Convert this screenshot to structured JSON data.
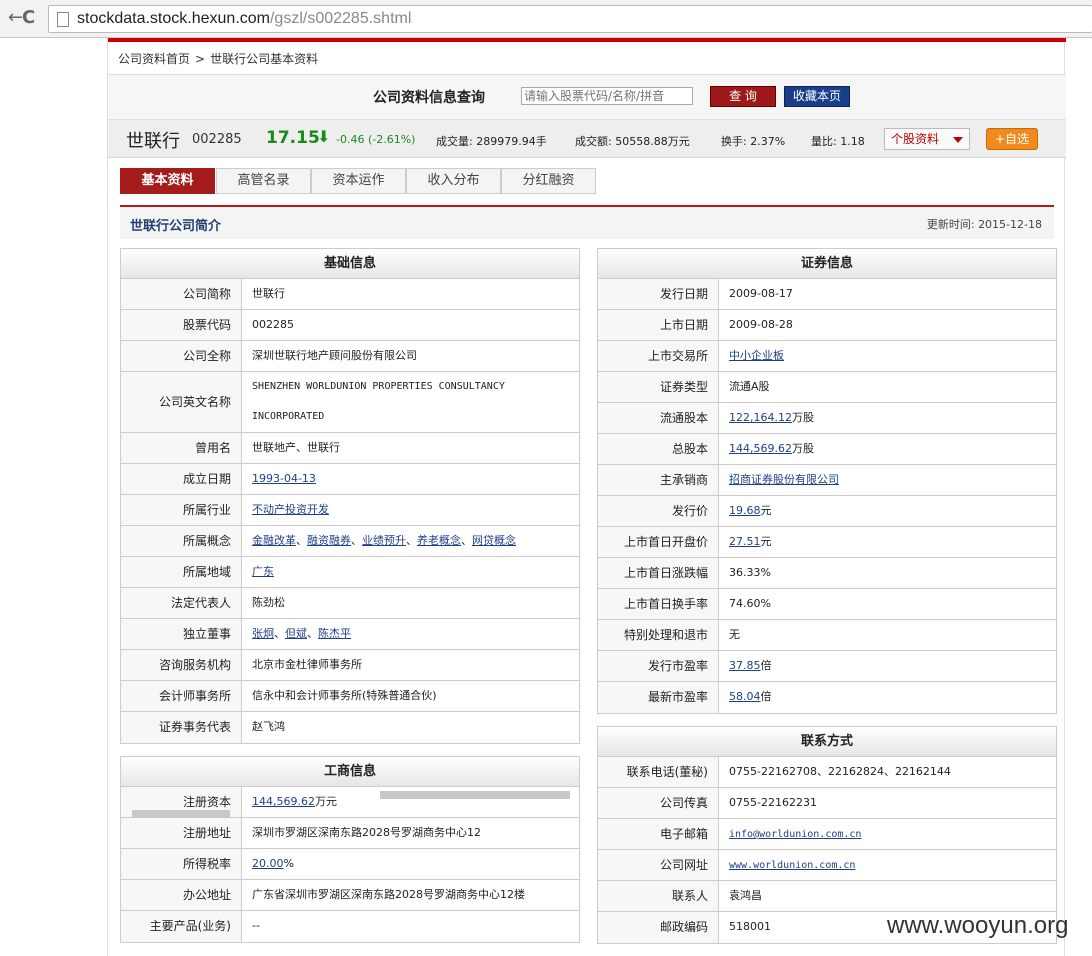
{
  "browser": {
    "back_glyph": "←",
    "reload_glyph": "C",
    "url_host": "stockdata.stock.hexun.com",
    "url_path": "/gszl/s002285.shtml"
  },
  "breadcrumb": {
    "home": "公司资料首页",
    "sep": ">",
    "current": "世联行公司基本资料"
  },
  "query": {
    "title": "公司资料信息查询",
    "placeholder": "请输入股票代码/名称/拼音",
    "search_btn": "查 询",
    "fav_btn": "收藏本页"
  },
  "stock": {
    "name": "世联行",
    "code": "002285",
    "price": "17.15",
    "arrow": "⬇",
    "change": "-0.46 (-2.61%)",
    "volume_label": "成交量:",
    "volume": "289979.94手",
    "amount_label": "成交额:",
    "amount": "50558.88万元",
    "turnover_label": "换手:",
    "turnover": "2.37%",
    "ratio_label": "量比:",
    "ratio": "1.18",
    "profile_dd": "个股资料",
    "watch_btn": "+自选"
  },
  "tabs": [
    "基本资料",
    "高管名录",
    "资本运作",
    "收入分布",
    "分红融资"
  ],
  "intro": {
    "title": "世联行公司简介",
    "updated_label": "更新时间:",
    "updated": "2015-12-18"
  },
  "basic": {
    "header": "基础信息",
    "rows": [
      {
        "label": "公司简称",
        "value": "世联行"
      },
      {
        "label": "股票代码",
        "value": "002285"
      },
      {
        "label": "公司全称",
        "value": "深圳世联行地产顾问股份有限公司"
      },
      {
        "label": "公司英文名称",
        "value": "SHENZHEN WORLDUNION PROPERTIES CONSULTANCY INCORPORATED"
      },
      {
        "label": "曾用名",
        "value": "世联地产、世联行"
      },
      {
        "label": "成立日期",
        "value": "1993-04-13"
      },
      {
        "label": "所属行业",
        "value": "不动产投资开发"
      },
      {
        "label": "所属概念",
        "concepts": [
          "金融改革",
          "融资融券",
          "业绩预升",
          "养老概念",
          "网贷概念"
        ]
      },
      {
        "label": "所属地域",
        "value": "广东"
      },
      {
        "label": "法定代表人",
        "value": "陈劲松"
      },
      {
        "label": "独立董事",
        "directors": [
          "张炯",
          "但斌",
          "陈杰平"
        ]
      },
      {
        "label": "咨询服务机构",
        "value": "北京市金杜律师事务所"
      },
      {
        "label": "会计师事务所",
        "value": "信永中和会计师事务所(特殊普通合伙)"
      },
      {
        "label": "证券事务代表",
        "value": "赵飞鸿"
      }
    ]
  },
  "commerce": {
    "header": "工商信息",
    "rows": [
      {
        "label": "注册资本",
        "value": "144,569.62",
        "unit": "万元"
      },
      {
        "label": "注册地址",
        "value": "深圳市罗湖区深南东路2028号罗湖商务中心12"
      },
      {
        "label": "所得税率",
        "value": "20.00",
        "unit": "%"
      },
      {
        "label": "办公地址",
        "value": "广东省深圳市罗湖区深南东路2028号罗湖商务中心12楼"
      },
      {
        "label": "主要产品(业务)",
        "value": "--"
      }
    ]
  },
  "securities": {
    "header": "证券信息",
    "rows": [
      {
        "label": "发行日期",
        "value": "2009-08-17"
      },
      {
        "label": "上市日期",
        "value": "2009-08-28"
      },
      {
        "label": "上市交易所",
        "value": "中小企业板",
        "unit": ""
      },
      {
        "label": "证券类型",
        "value": "流通A股"
      },
      {
        "label": "流通股本",
        "value": "122,164.12",
        "unit": "万股"
      },
      {
        "label": "总股本",
        "value": "144,569.62",
        "unit": "万股"
      },
      {
        "label": "主承销商",
        "value": "招商证券股份有限公司",
        "unit": ""
      },
      {
        "label": "发行价",
        "value": "19.68",
        "unit": "元"
      },
      {
        "label": "上市首日开盘价",
        "value": "27.51",
        "unit": "元"
      },
      {
        "label": "上市首日涨跌幅",
        "value": "36.33%"
      },
      {
        "label": "上市首日换手率",
        "value": "74.60%"
      },
      {
        "label": "特别处理和退市",
        "value": "无"
      },
      {
        "label": "发行市盈率",
        "value": "37.85",
        "unit": "倍"
      },
      {
        "label": "最新市盈率",
        "value": "58.04",
        "unit": "倍"
      }
    ]
  },
  "contact": {
    "header": "联系方式",
    "rows": [
      {
        "label": "联系电话(董秘)",
        "value": "0755-22162708、22162824、22162144"
      },
      {
        "label": "公司传真",
        "value": "0755-22162231"
      },
      {
        "label": "电子邮箱",
        "value": "info@worldunion.com.cn"
      },
      {
        "label": "公司网址",
        "value": "www.worldunion.com.cn"
      },
      {
        "label": "联系人",
        "value": "袁鸿昌"
      },
      {
        "label": "邮政编码",
        "value": "518001"
      }
    ]
  },
  "watermark": "www.wooyun.org"
}
